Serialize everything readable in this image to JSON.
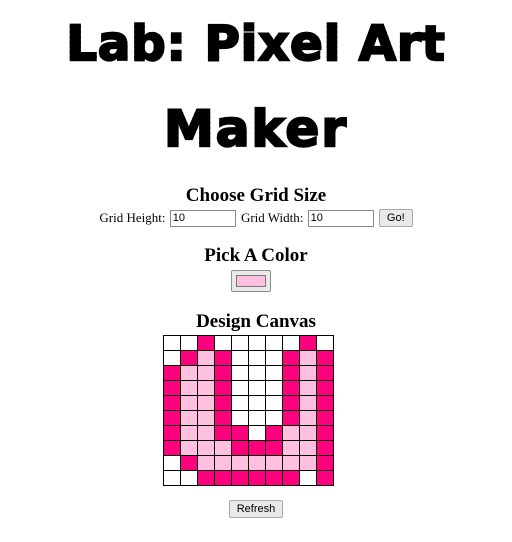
{
  "title": {
    "line1": "Lab: Pixel Art",
    "line2": "Maker"
  },
  "size_section": {
    "heading": "Choose Grid Size",
    "height_label": "Grid Height:",
    "height_value": "10",
    "width_label": "Grid Width:",
    "width_value": "10",
    "submit_label": "Go!"
  },
  "color_section": {
    "heading": "Pick A Color",
    "selected_color": "#ffc0e0"
  },
  "canvas_section": {
    "heading": "Design Canvas",
    "rows": 10,
    "cols": 10,
    "palette": {
      "W": "#ffffff",
      "D": "#ff007f",
      "L": "#ffc0e0"
    },
    "grid": [
      "WWDWWWWWDW",
      "WDLDWWWDLD",
      "DLLDWWWDLD",
      "DLLDWWWDLD",
      "DLLDWWWDLD",
      "DLLDWWWDLD",
      "DLLDDWDLLD",
      "DLLLDDDLLD",
      "WDLLLLLLLD",
      "WWDDDDDDWD"
    ]
  },
  "refresh_label": "Refresh"
}
